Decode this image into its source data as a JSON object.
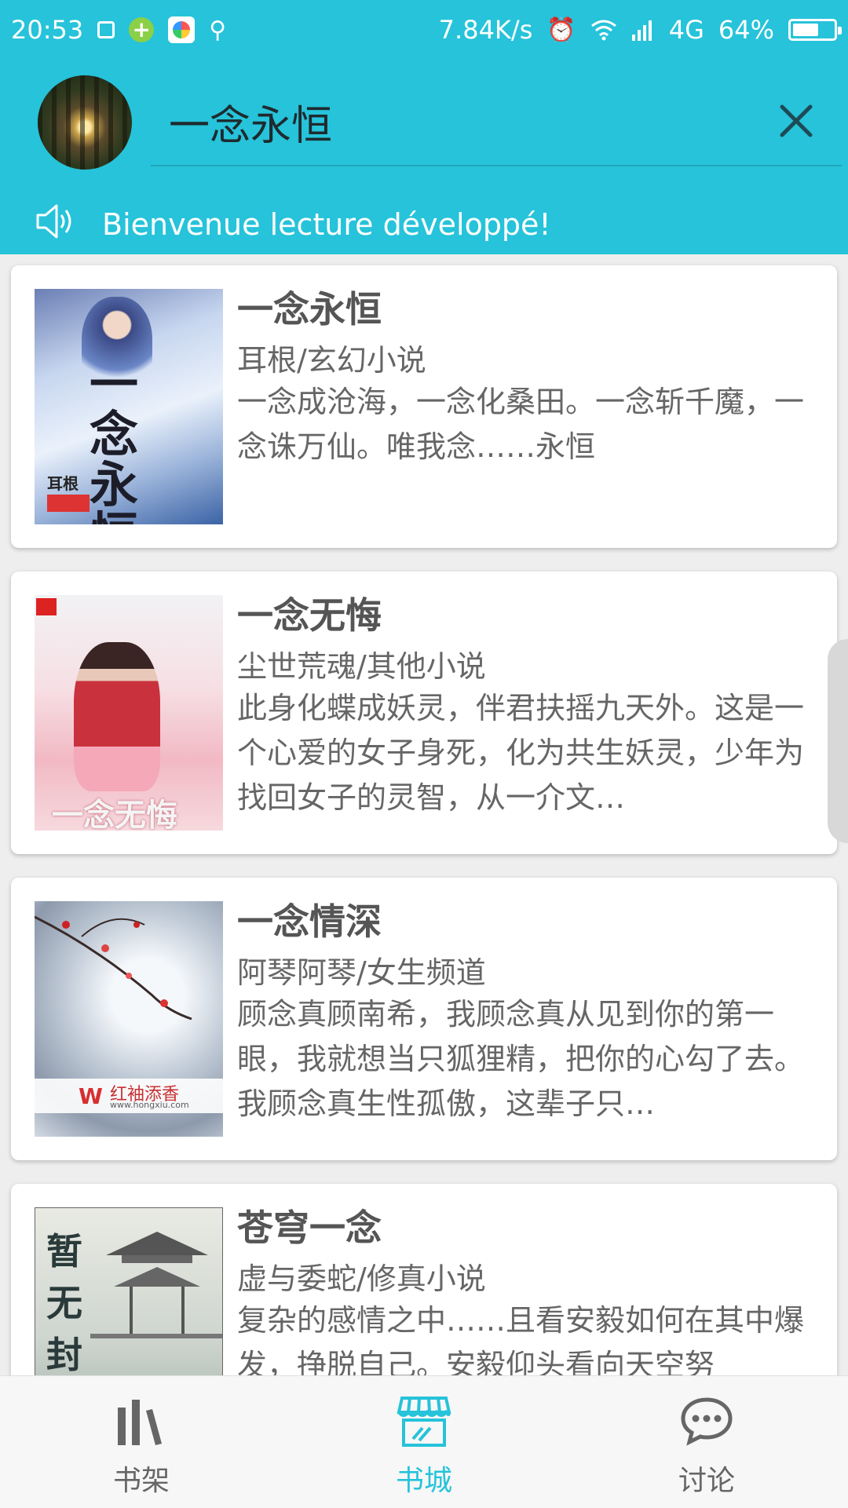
{
  "status_bar": {
    "time": "20:53",
    "network_speed": "7.84K/s",
    "network_type": "4G",
    "battery": "64%",
    "battery_level": 0.64
  },
  "header": {
    "search_query": "一念永恒",
    "announcement": "Bienvenue lecture développé!"
  },
  "books": [
    {
      "title": "一念永恒",
      "author_category": "耳根/玄幻小说",
      "description": "一念成沧海，一念化桑田。一念斩千魔，一念诛万仙。唯我念……永恒"
    },
    {
      "title": "一念无悔",
      "author_category": "尘世荒魂/其他小说",
      "description": "此身化蝶成妖灵，伴君扶摇九天外。这是一个心爱的女子身死，化为共生妖灵，少年为找回女子的灵智，从一介文…"
    },
    {
      "title": "一念情深",
      "author_category": "阿琴阿琴/女生频道",
      "description": "顾念真顾南希，我顾念真从见到你的第一眼，我就想当只狐狸精，把你的心勾了去。我顾念真生性孤傲，这辈子只…"
    },
    {
      "title": "苍穹一念",
      "author_category": "虚与委蛇/修真小说",
      "description": "复杂的感情之中……且看安毅如何在其中爆发，挣脱自己。安毅仰头看向天空努"
    }
  ],
  "covers": {
    "book1_text": "一念永恒",
    "book1_author": "耳根",
    "book2_text": "一念无悔",
    "book3_brand": "红袖添香",
    "book3_url": "www.hongxiu.com",
    "book4_text": "暂无封面"
  },
  "nav": {
    "bookshelf": "书架",
    "bookstore": "书城",
    "discuss": "讨论",
    "active_color": "#26c3da",
    "inactive_color": "#666666"
  },
  "colors": {
    "primary": "#26c3da"
  }
}
